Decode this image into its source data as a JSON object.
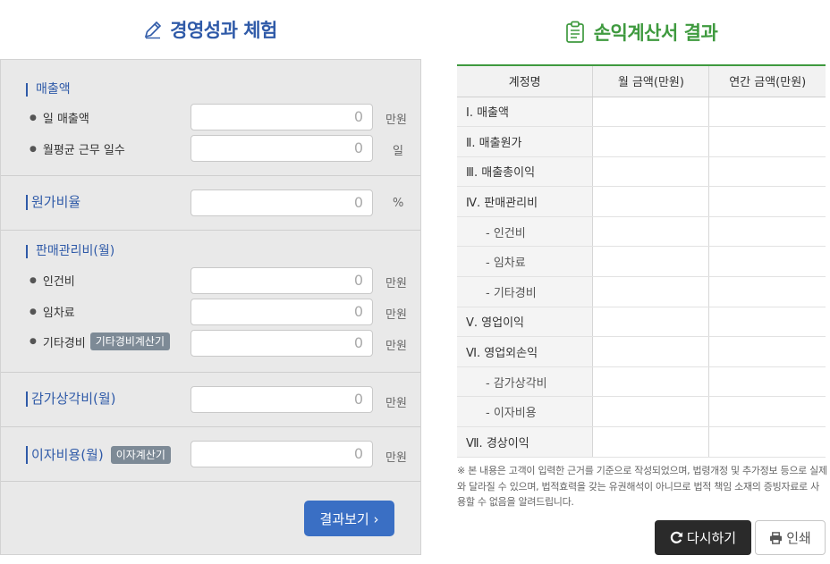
{
  "left": {
    "title": "경영성과 체험",
    "sections": {
      "sales": {
        "heading": "매출액",
        "daily_sales": {
          "label": "일 매출액",
          "value": "0",
          "unit": "만원"
        },
        "work_days": {
          "label": "월평균 근무 일수",
          "value": "0",
          "unit": "일"
        }
      },
      "cost_ratio": {
        "heading": "원가비율",
        "value": "0",
        "unit": "%"
      },
      "sga": {
        "heading": "판매관리비(월)",
        "labor": {
          "label": "인건비",
          "value": "0",
          "unit": "만원"
        },
        "rent": {
          "label": "임차료",
          "value": "0",
          "unit": "만원"
        },
        "other": {
          "label": "기타경비",
          "button": "기타경비계산기",
          "value": "0",
          "unit": "만원"
        }
      },
      "depreciation": {
        "heading": "감가상각비(월)",
        "value": "0",
        "unit": "만원"
      },
      "interest": {
        "heading": "이자비용(월)",
        "button": "이자계산기",
        "value": "0",
        "unit": "만원"
      }
    },
    "result_button": "결과보기 ›"
  },
  "right": {
    "title": "손익계산서 결과",
    "table": {
      "headers": [
        "계정명",
        "월 금액(만원)",
        "연간 금액(만원)"
      ],
      "rows": [
        {
          "name": "Ⅰ. 매출액",
          "sub": false
        },
        {
          "name": "Ⅱ. 매출원가",
          "sub": false
        },
        {
          "name": "Ⅲ. 매출총이익",
          "sub": false
        },
        {
          "name": "Ⅳ. 판매관리비",
          "sub": false
        },
        {
          "name": "- 인건비",
          "sub": true
        },
        {
          "name": "- 임차료",
          "sub": true
        },
        {
          "name": "- 기타경비",
          "sub": true
        },
        {
          "name": "Ⅴ. 영업이익",
          "sub": false
        },
        {
          "name": "Ⅵ. 영업외손익",
          "sub": false
        },
        {
          "name": "- 감가상각비",
          "sub": true
        },
        {
          "name": "- 이자비용",
          "sub": true
        },
        {
          "name": "Ⅶ. 경상이익",
          "sub": false
        }
      ]
    },
    "notice": "※ 본 내용은 고객이 입력한 근거를 기준으로 작성되었으며, 법령개정 및 추가정보 등으로 실제와 달라질 수 있으며, 법적효력을 갖는 유권해석이 아니므로 법적 책임 소재의 증빙자료로 사용할 수 없음을 알려드립니다.",
    "buttons": {
      "reset": "다시하기",
      "print": "인쇄"
    }
  },
  "colors": {
    "blue_accent": "#2f5aa8",
    "green_accent": "#3f9a3f",
    "button_blue": "#3a6fc4",
    "button_dark": "#2a2a2a"
  },
  "icons": [
    "pencil-icon",
    "clipboard-icon",
    "refresh-icon",
    "printer-icon",
    "chevron-right-icon"
  ]
}
